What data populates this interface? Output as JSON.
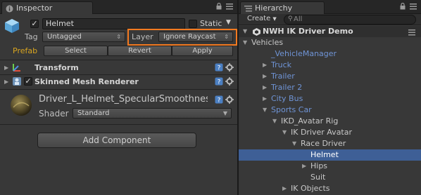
{
  "colors": {
    "accent_blue": "#6f94d6",
    "selection": "#3e5f96",
    "highlight_border": "#f47a20",
    "prefab_label": "#d9a520",
    "panel_bg": "#383838"
  },
  "inspector": {
    "tab_label": "Inspector",
    "object_name": "Helmet",
    "static_label": "Static",
    "tag_label": "Tag",
    "tag_value": "Untagged",
    "layer_label": "Layer",
    "layer_value": "Ignore Raycast",
    "prefab_label": "Prefab",
    "prefab_buttons": [
      "Select",
      "Revert",
      "Apply"
    ],
    "components": [
      {
        "name": "Transform",
        "icon": "transform-icon"
      },
      {
        "name": "Skinned Mesh Renderer",
        "icon": "mesh-renderer-icon"
      }
    ],
    "material": {
      "name": "Driver_L_Helmet_SpecularSmoothnes",
      "shader_label": "Shader",
      "shader_value": "Standard"
    },
    "add_component_label": "Add Component"
  },
  "hierarchy": {
    "tab_label": "Hierarchy",
    "create_label": "Create",
    "search_placeholder": "All",
    "scene_name": "NWH IK Driver Demo",
    "items": [
      {
        "label": "Vehicles",
        "tone": "white",
        "expanded": true
      },
      {
        "label": "_VehicleManager",
        "tone": "blue"
      },
      {
        "label": "Truck",
        "tone": "blue",
        "collapsed": true
      },
      {
        "label": "Trailer",
        "tone": "blue",
        "collapsed": true
      },
      {
        "label": "Trailer 2",
        "tone": "blue",
        "collapsed": true
      },
      {
        "label": "City Bus",
        "tone": "blue",
        "collapsed": true
      },
      {
        "label": "Sports Car",
        "tone": "blue",
        "expanded": true
      },
      {
        "label": "IKD_Avatar Rig",
        "tone": "white",
        "expanded": true
      },
      {
        "label": "IK Driver Avatar",
        "tone": "white",
        "expanded": true
      },
      {
        "label": "Race Driver",
        "tone": "white",
        "expanded": true
      },
      {
        "label": "Helmet",
        "tone": "white",
        "selected": true
      },
      {
        "label": "Hips",
        "tone": "white",
        "collapsed": true
      },
      {
        "label": "Suit",
        "tone": "white"
      },
      {
        "label": "IK Objects",
        "tone": "white",
        "collapsed": true
      }
    ]
  }
}
